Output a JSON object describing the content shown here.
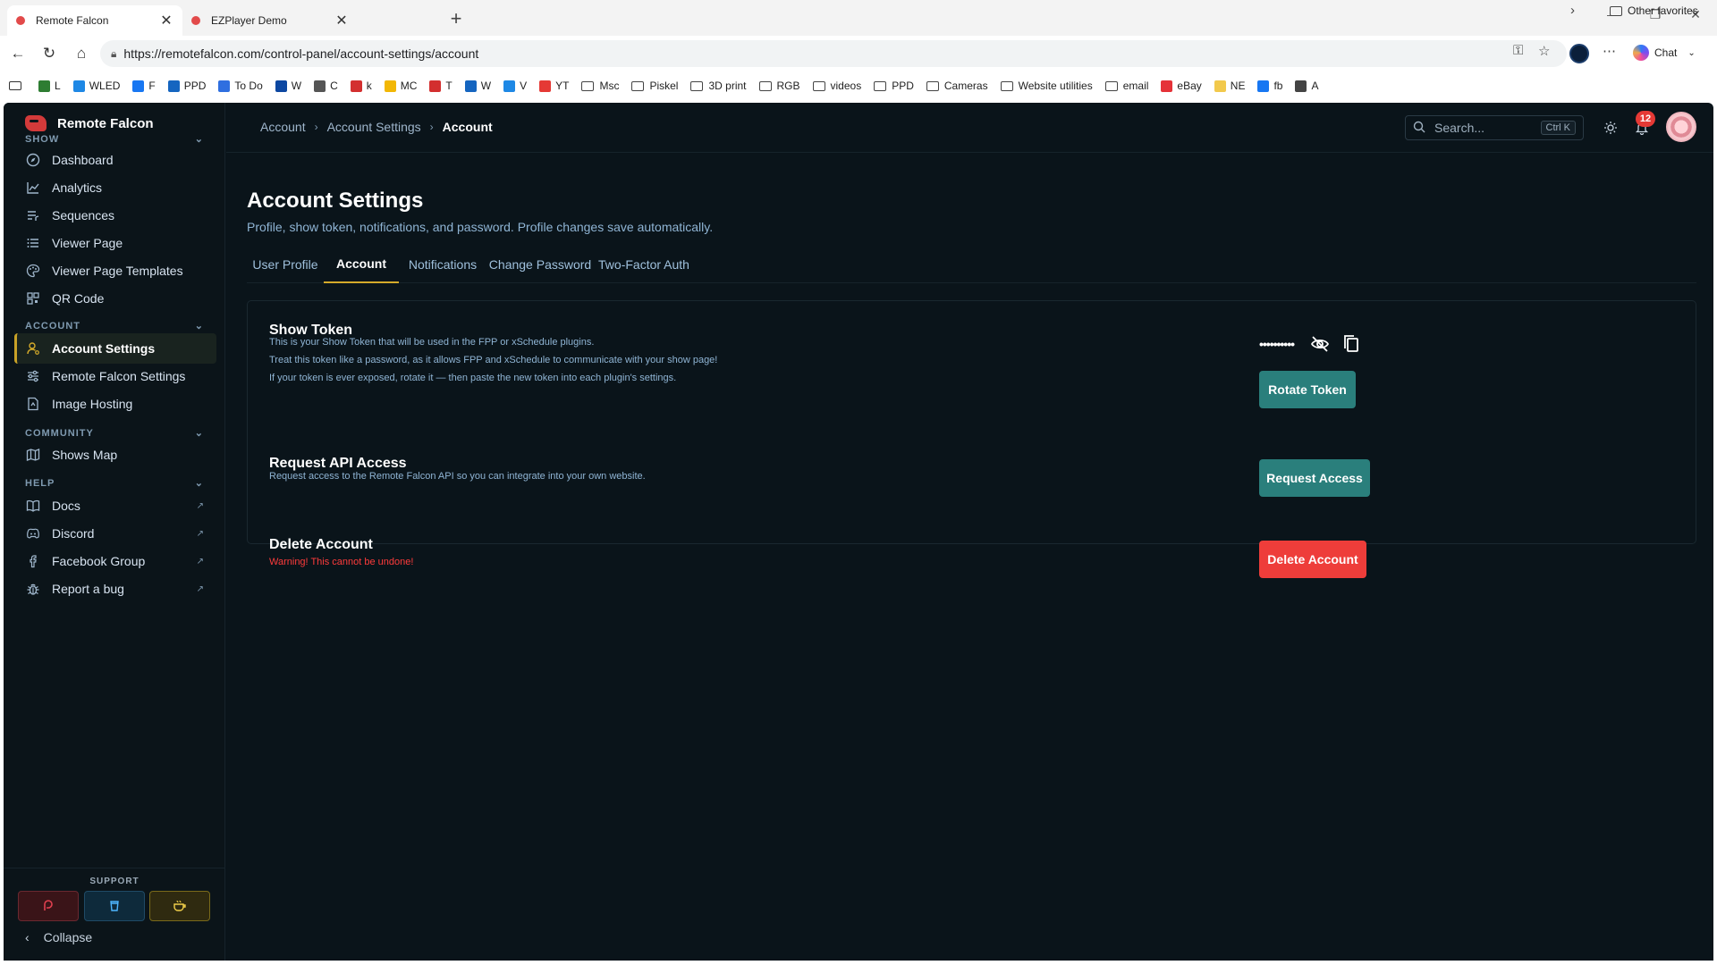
{
  "browser": {
    "tabs": [
      {
        "title": "Remote Falcon",
        "active": true
      },
      {
        "title": "EZPlayer Demo",
        "active": false
      }
    ],
    "url": "https://remotefalcon.com/control-panel/account-settings/account",
    "chat_label": "Chat",
    "bookmarks": [
      {
        "label": "L",
        "icon": "flag-icon",
        "color": "#2e7d32"
      },
      {
        "label": "WLED",
        "icon": "wled-icon",
        "color": "#1e88e5"
      },
      {
        "label": "F",
        "icon": "facebook-icon",
        "color": "#1877f2"
      },
      {
        "label": "PPD",
        "icon": "ppd-icon",
        "color": "#1565c0"
      },
      {
        "label": "To Do",
        "icon": "todo-icon",
        "color": "#2f6fe0"
      },
      {
        "label": "W",
        "icon": "w-icon",
        "color": "#0d47a1"
      },
      {
        "label": "C",
        "icon": "c-icon",
        "color": "#555555"
      },
      {
        "label": "k",
        "icon": "key-icon",
        "color": "#d32f2f"
      },
      {
        "label": "MC",
        "icon": "mc-icon",
        "color": "#f2b705"
      },
      {
        "label": "T",
        "icon": "t-icon",
        "color": "#d32f2f"
      },
      {
        "label": "W",
        "icon": "star-icon",
        "color": "#1565c0"
      },
      {
        "label": "V",
        "icon": "v-icon",
        "color": "#1e88e5"
      },
      {
        "label": "YT",
        "icon": "youtube-icon",
        "color": "#e53935"
      },
      {
        "label": "Msc",
        "icon": "folder-icon"
      },
      {
        "label": "Piskel",
        "icon": "folder-icon"
      },
      {
        "label": "3D print",
        "icon": "folder-icon"
      },
      {
        "label": "RGB",
        "icon": "folder-icon"
      },
      {
        "label": "videos",
        "icon": "folder-icon"
      },
      {
        "label": "PPD",
        "icon": "folder-icon"
      },
      {
        "label": "Cameras",
        "icon": "folder-icon"
      },
      {
        "label": "Website utilities",
        "icon": "folder-icon"
      },
      {
        "label": "email",
        "icon": "folder-icon"
      },
      {
        "label": "eBay",
        "icon": "ebay-icon",
        "color": "#e53238"
      },
      {
        "label": "NE",
        "icon": "ne-icon",
        "color": "#f2c94c"
      },
      {
        "label": "fb",
        "icon": "facebook-icon",
        "color": "#1877f2"
      },
      {
        "label": "A",
        "icon": "globe-icon",
        "color": "#444444"
      }
    ],
    "other_favorites": "Other favorites"
  },
  "sidebar": {
    "brand": "Remote Falcon",
    "sections": {
      "show": "SHOW",
      "account": "ACCOUNT",
      "community": "COMMUNITY",
      "help": "HELP"
    },
    "show_items": [
      "Dashboard",
      "Analytics",
      "Sequences",
      "Viewer Page",
      "Viewer Page Templates",
      "QR Code"
    ],
    "account_items": [
      "Account Settings",
      "Remote Falcon Settings",
      "Image Hosting"
    ],
    "community_items": [
      "Shows Map"
    ],
    "help_items": [
      "Docs",
      "Discord",
      "Facebook Group",
      "Report a bug"
    ],
    "active_item": "Account Settings",
    "support_label": "SUPPORT",
    "collapse_label": "Collapse"
  },
  "topbar": {
    "breadcrumbs": [
      "Account",
      "Account Settings",
      "Account"
    ],
    "search_placeholder": "Search...",
    "search_shortcut": "Ctrl K",
    "notification_count": "12"
  },
  "page": {
    "title": "Account Settings",
    "subtitle": "Profile, show token, notifications, and password. Profile changes save automatically.",
    "tabs": [
      "User Profile",
      "Account",
      "Notifications",
      "Change Password",
      "Two-Factor Auth"
    ],
    "active_tab": "Account"
  },
  "show_token": {
    "title": "Show Token",
    "desc_1": "This is your Show Token that will be used in the FPP or xSchedule plugins.",
    "desc_2": "Treat this token like a password, as it allows FPP and xSchedule to communicate with your show page!",
    "desc_3": "If your token is ever exposed, rotate it — then paste the new token into each plugin's settings.",
    "masked_value": "••••••••••",
    "rotate_label": "Rotate Token"
  },
  "api_access": {
    "title": "Request API Access",
    "desc": "Request access to the Remote Falcon API so you can integrate into your own website.",
    "button_label": "Request Access"
  },
  "delete_account": {
    "title": "Delete Account",
    "warning": "Warning! This cannot be undone!",
    "button_label": "Delete Account"
  },
  "colors": {
    "accent_teal": "#2a7f7c",
    "danger_red": "#ee3d3a",
    "active_gold": "#d4aa2a",
    "app_bg": "#0a141a"
  }
}
